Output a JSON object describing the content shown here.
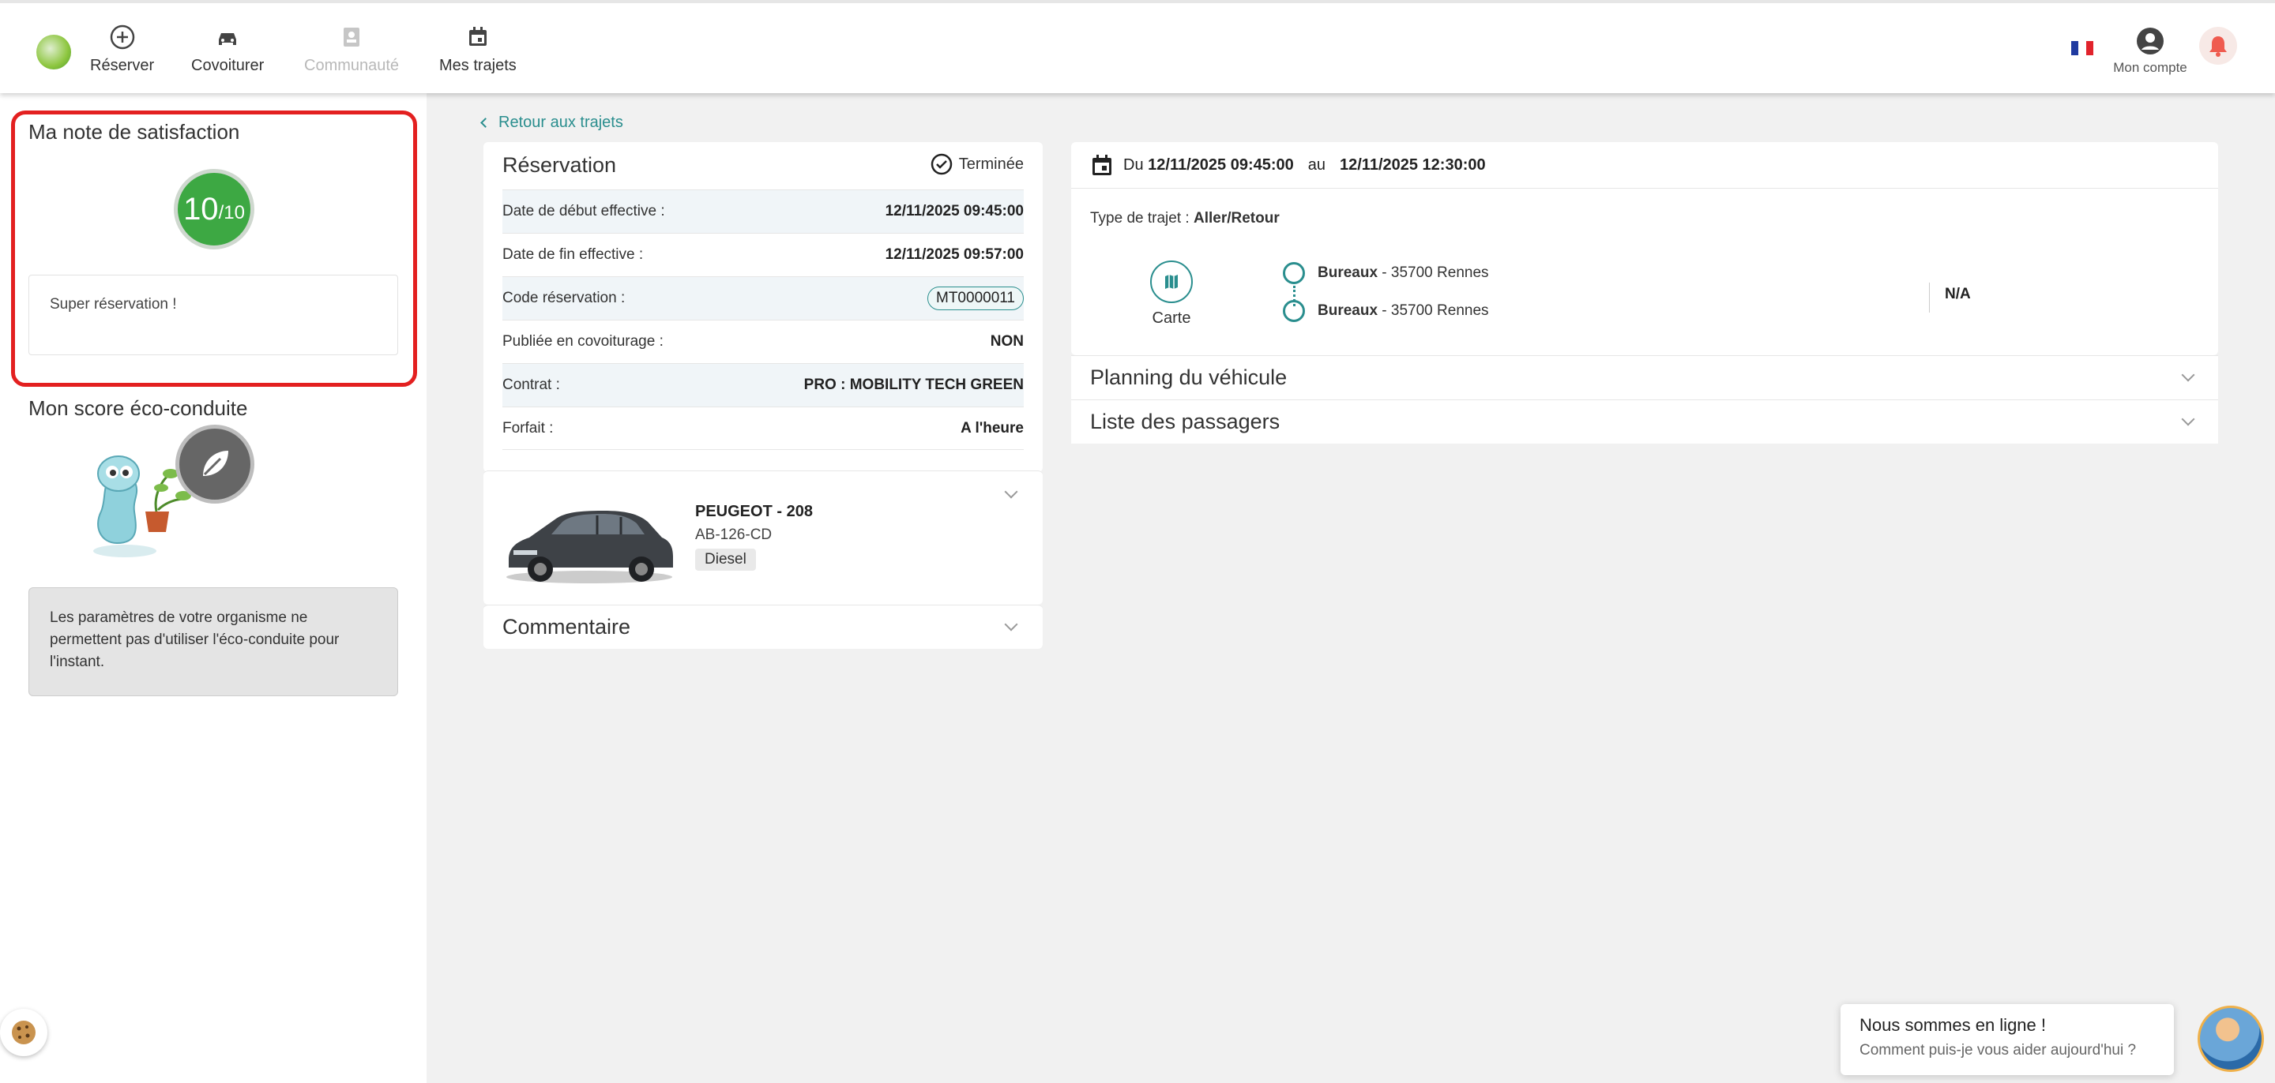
{
  "header": {
    "nav": [
      {
        "label": "Réserver"
      },
      {
        "label": "Covoiturer"
      },
      {
        "label": "Communauté"
      },
      {
        "label": "Mes trajets"
      }
    ],
    "account_label": "Mon compte"
  },
  "sidebar": {
    "satisfaction_title": "Ma note de satisfaction",
    "score_value": "10",
    "score_max": "/10",
    "comment": "Super réservation !",
    "eco_title": "Mon score éco-conduite",
    "eco_message": "Les paramètres de votre organisme ne permettent pas d'utiliser l'éco-conduite pour l'instant."
  },
  "main": {
    "back_label": "Retour aux trajets",
    "reservation": {
      "title": "Réservation",
      "status": "Terminée",
      "rows": [
        {
          "label": "Date de début effective :",
          "value": "12/11/2025 09:45:00"
        },
        {
          "label": "Date de fin effective :",
          "value": "12/11/2025 09:57:00"
        },
        {
          "label": "Code réservation :",
          "value": "MT0000011"
        },
        {
          "label": "Publiée en covoiturage :",
          "value": "NON"
        },
        {
          "label": "Contrat :",
          "value": "PRO : MOBILITY TECH GREEN"
        },
        {
          "label": "Forfait :",
          "value": "A l'heure"
        }
      ]
    },
    "vehicle": {
      "name": "PEUGEOT - 208",
      "plate": "AB-126-CD",
      "fuel": "Diesel"
    },
    "comment_title": "Commentaire",
    "trip": {
      "du": "Du",
      "start": "12/11/2025 09:45:00",
      "au": "au",
      "end": "12/11/2025 12:30:00",
      "type_label": "Type de trajet :",
      "type_value": "Aller/Retour",
      "map_label": "Carte",
      "stops": [
        {
          "name": "Bureaux",
          "address": " - 35700 Rennes"
        },
        {
          "name": "Bureaux",
          "address": " - 35700 Rennes"
        }
      ],
      "na": "N/A"
    },
    "planning_title": "Planning du véhicule",
    "passengers_title": "Liste des passagers"
  },
  "chat": {
    "title": "Nous sommes en ligne !",
    "subtitle": "Comment puis-je vous aider aujourd'hui ?"
  },
  "colors": {
    "accent": "#2a8e8e",
    "score_green": "#3da843",
    "highlight_red": "#e32020"
  }
}
